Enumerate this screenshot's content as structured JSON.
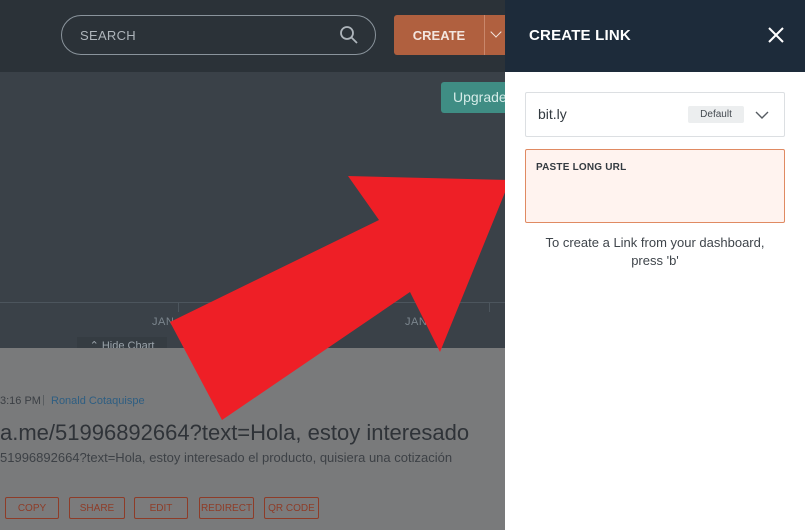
{
  "header": {
    "search_placeholder": "SEARCH",
    "create_label": "CREATE"
  },
  "chart_area": {
    "upgrade_label": "Upgrade",
    "month_label_1": "JAN",
    "month_label_2": "JAN",
    "hide_chart_label": "Hide Chart"
  },
  "link": {
    "time": "3:16 PM",
    "separator": "|",
    "author": "Ronald Cotaquispe",
    "title": "a.me/51996892664?text=Hola, estoy interesado",
    "long_url": "51996892664?text=Hola, estoy interesado el producto, quisiera una cotización",
    "actions": [
      "COPY",
      "SHARE",
      "EDIT",
      "REDIRECT",
      "QR CODE"
    ]
  },
  "panel": {
    "title": "CREATE LINK",
    "domain": "bit.ly",
    "default_badge": "Default",
    "url_label": "PASTE LONG URL",
    "hint": "To create a Link from your dashboard, press 'b'"
  },
  "colors": {
    "panel_header": "#1d2b3a",
    "accent_orange": "#e08a62",
    "arrow_red": "#ee1f26",
    "upgrade_teal": "#3f8d84"
  }
}
